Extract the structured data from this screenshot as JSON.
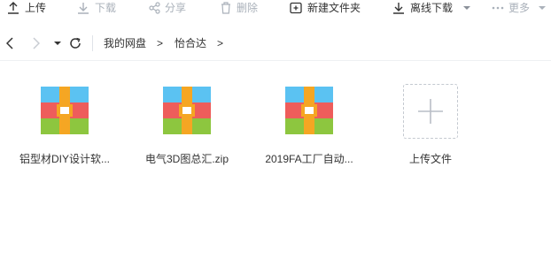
{
  "toolbar": {
    "upload": "上传",
    "download": "下载",
    "share": "分享",
    "delete": "删除",
    "new_folder": "新建文件夹",
    "offline_download": "离线下载",
    "more": "更多"
  },
  "breadcrumb": {
    "root": "我的网盘",
    "sep1": ">",
    "folder": "怡合达",
    "sep2": ">"
  },
  "files": [
    {
      "name": "铝型材DIY设计软...",
      "icon": "archive-icon"
    },
    {
      "name": "电气3D图总汇.zip",
      "icon": "archive-icon"
    },
    {
      "name": "2019FA工厂自动...",
      "icon": "archive-icon"
    }
  ],
  "upload_tile": {
    "label": "上传文件",
    "icon": "plus-icon"
  },
  "colors": {
    "archive_top": "#5bc2f2",
    "archive_middle": "#ee5d5b",
    "archive_bottom": "#8dc63f",
    "archive_strap": "#f5a623",
    "text": "#333333",
    "disabled": "#aab1ba"
  }
}
